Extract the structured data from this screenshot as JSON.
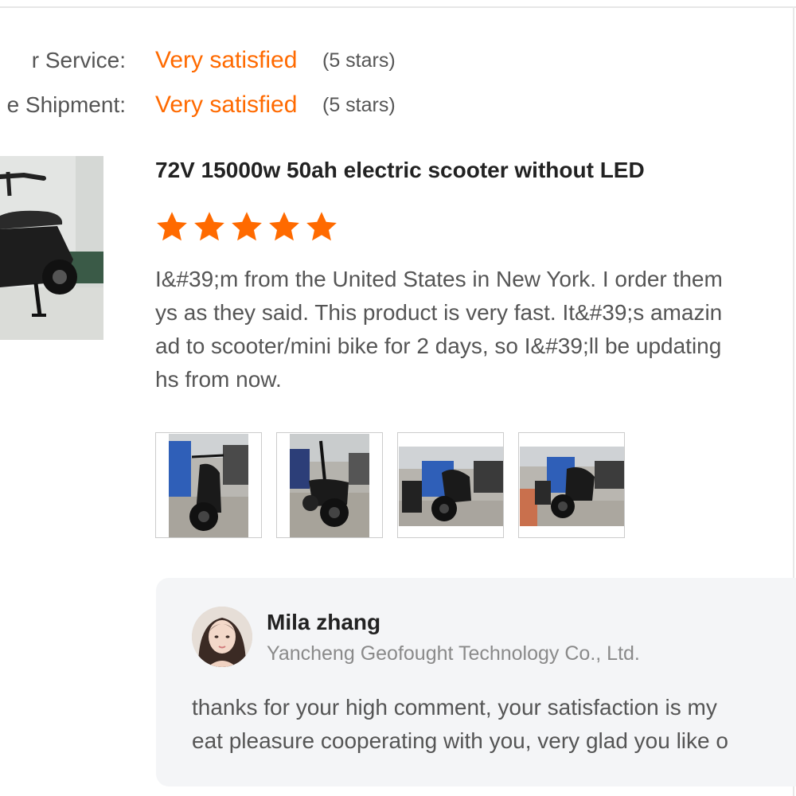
{
  "ratings": [
    {
      "label": "r Service:",
      "value": "Very satisfied",
      "stars_text": "(5 stars)"
    },
    {
      "label": "e Shipment:",
      "value": "Very satisfied",
      "stars_text": "(5 stars)"
    }
  ],
  "product": {
    "title": "72V 15000w 50ah electric scooter without LED",
    "rating_stars": 5
  },
  "review": {
    "lines": [
      "I&#39;m from the United States in New York. I order them",
      "ys as they said.  This product is very fast. It&#39;s amazin",
      "ad to scooter/mini bike for 2 days, so I&#39;ll be updating",
      "hs from now."
    ],
    "photos": [
      {
        "icon": "scooter-photo"
      },
      {
        "icon": "scooter-photo"
      },
      {
        "icon": "scooter-photo"
      },
      {
        "icon": "scooter-photo"
      }
    ]
  },
  "reply": {
    "name": "Mila zhang",
    "company": "Yancheng Geofought Technology Co., Ltd.",
    "lines": [
      "thanks for your high comment, your satisfaction is my",
      "eat pleasure cooperating with you, very glad you like o"
    ]
  },
  "colors": {
    "accent": "#ff6a00",
    "text": "#555555",
    "heading": "#222222",
    "muted": "#8a8a8a",
    "reply_bg": "#f4f5f7"
  }
}
